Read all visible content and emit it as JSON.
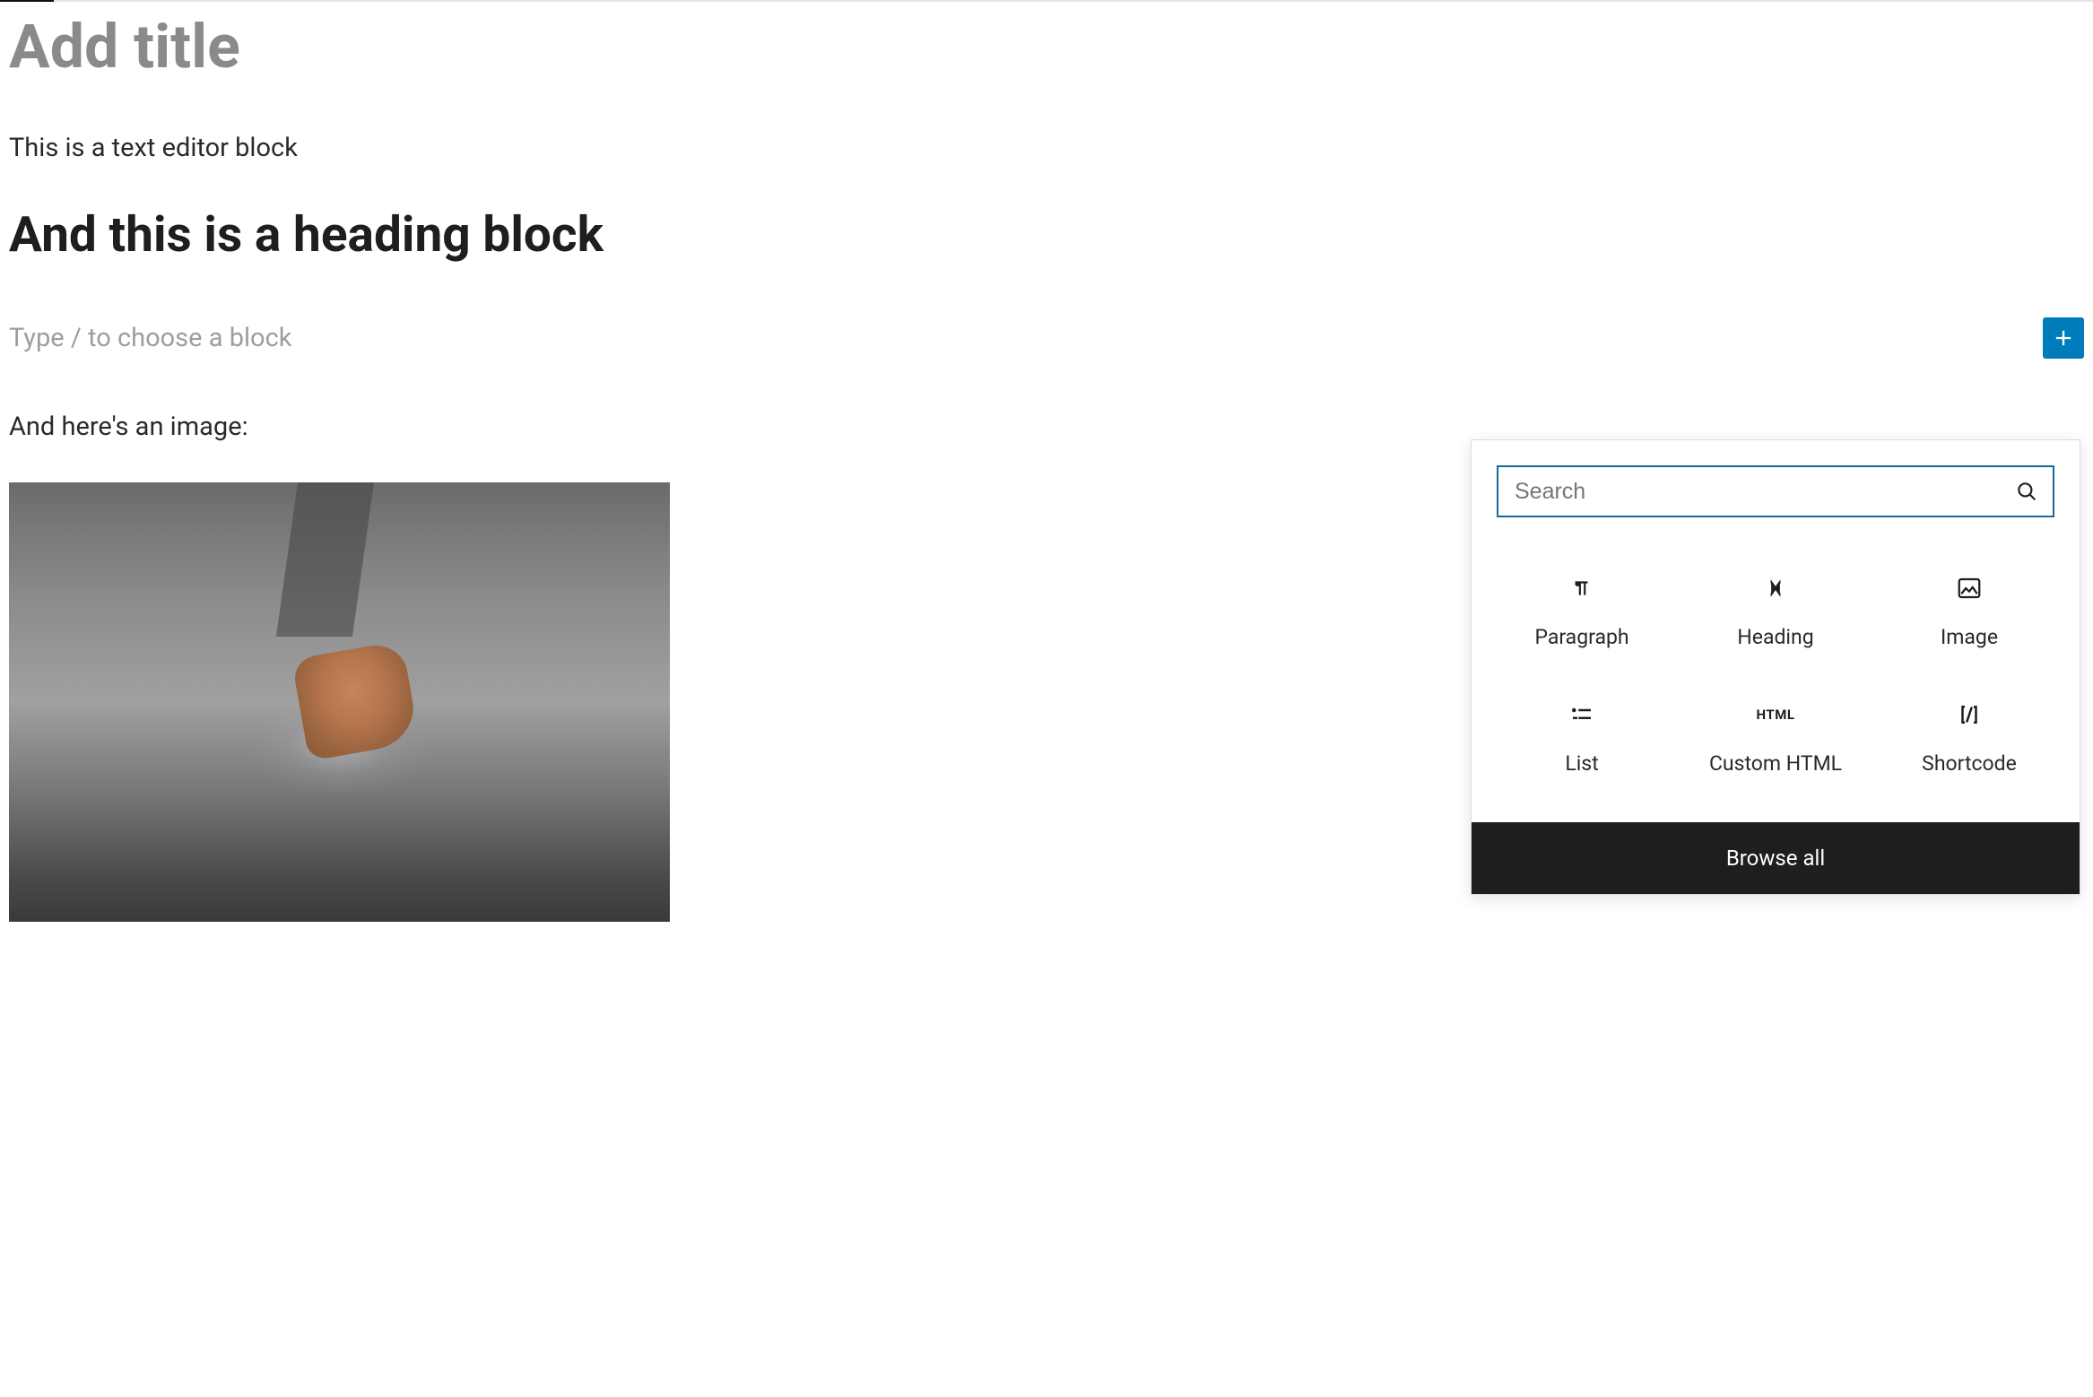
{
  "editor": {
    "title_placeholder": "Add title",
    "paragraph1": "This is a text editor block",
    "heading": "And this is a heading block",
    "block_placeholder": "Type / to choose a block",
    "paragraph2": "And here's an image:"
  },
  "inserter": {
    "search_placeholder": "Search",
    "blocks": [
      {
        "label": "Paragraph",
        "icon": "paragraph"
      },
      {
        "label": "Heading",
        "icon": "heading"
      },
      {
        "label": "Image",
        "icon": "image"
      },
      {
        "label": "List",
        "icon": "list"
      },
      {
        "label": "Custom HTML",
        "icon": "html"
      },
      {
        "label": "Shortcode",
        "icon": "shortcode"
      }
    ],
    "browse_all": "Browse all"
  },
  "colors": {
    "accent": "#007cba",
    "inserter_border": "#156a9e",
    "browse_bg": "#1e1e1e"
  }
}
